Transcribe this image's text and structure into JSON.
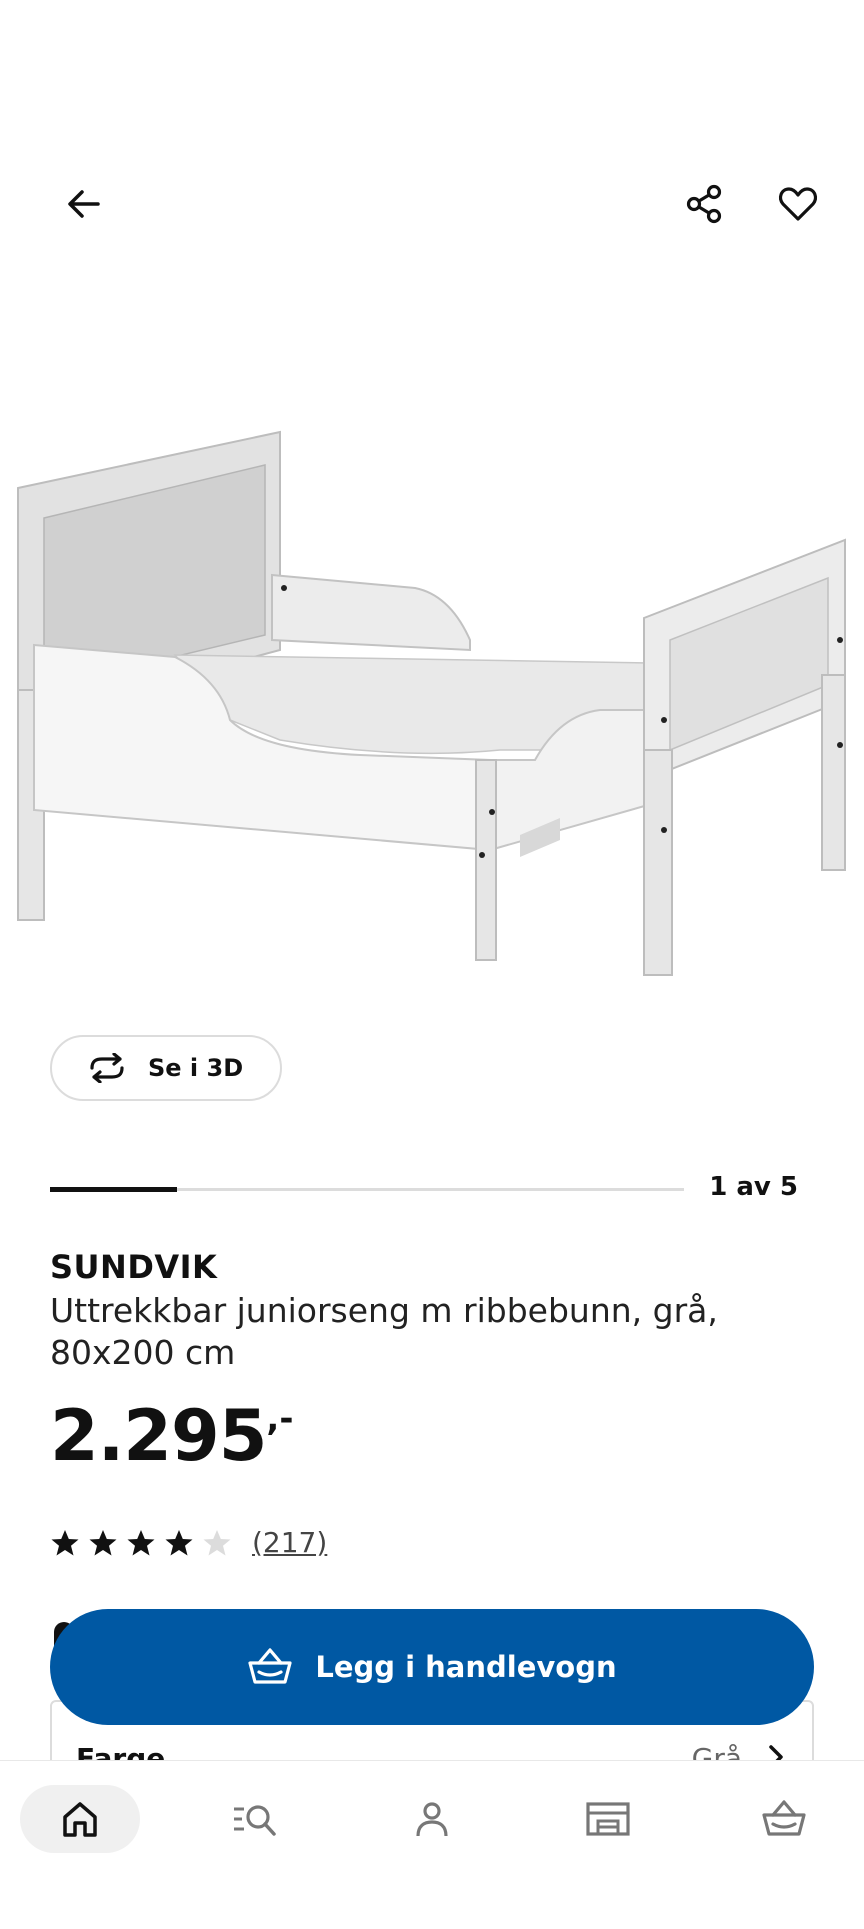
{
  "header": {
    "back_icon": "arrow-left-icon",
    "share_icon": "share-icon",
    "favorite_icon": "heart-icon"
  },
  "view3d": {
    "label": "Se i 3D",
    "icon": "rotate-3d-icon"
  },
  "gallery": {
    "position_label": "1 av 5",
    "current": 1,
    "total": 5
  },
  "product": {
    "brand": "SUNDVIK",
    "description": "Uttrekkbar juniorseng m ribbebunn, grå, 80x200 cm",
    "price_main": "2.295",
    "price_suffix": ",-",
    "rating_value": 4,
    "rating_max": 5,
    "review_count": "(217)"
  },
  "variant": {
    "label": "Farge",
    "value": "Grå"
  },
  "cart_button": {
    "label": "Legg i handlevogn",
    "icon": "basket-icon",
    "color": "#0058a3"
  },
  "bottom_nav": [
    {
      "name": "home",
      "icon": "home-icon",
      "active": true
    },
    {
      "name": "search",
      "icon": "search-list-icon",
      "active": false
    },
    {
      "name": "profile",
      "icon": "person-icon",
      "active": false
    },
    {
      "name": "store",
      "icon": "store-icon",
      "active": false
    },
    {
      "name": "cart",
      "icon": "basket-icon",
      "active": false
    }
  ]
}
